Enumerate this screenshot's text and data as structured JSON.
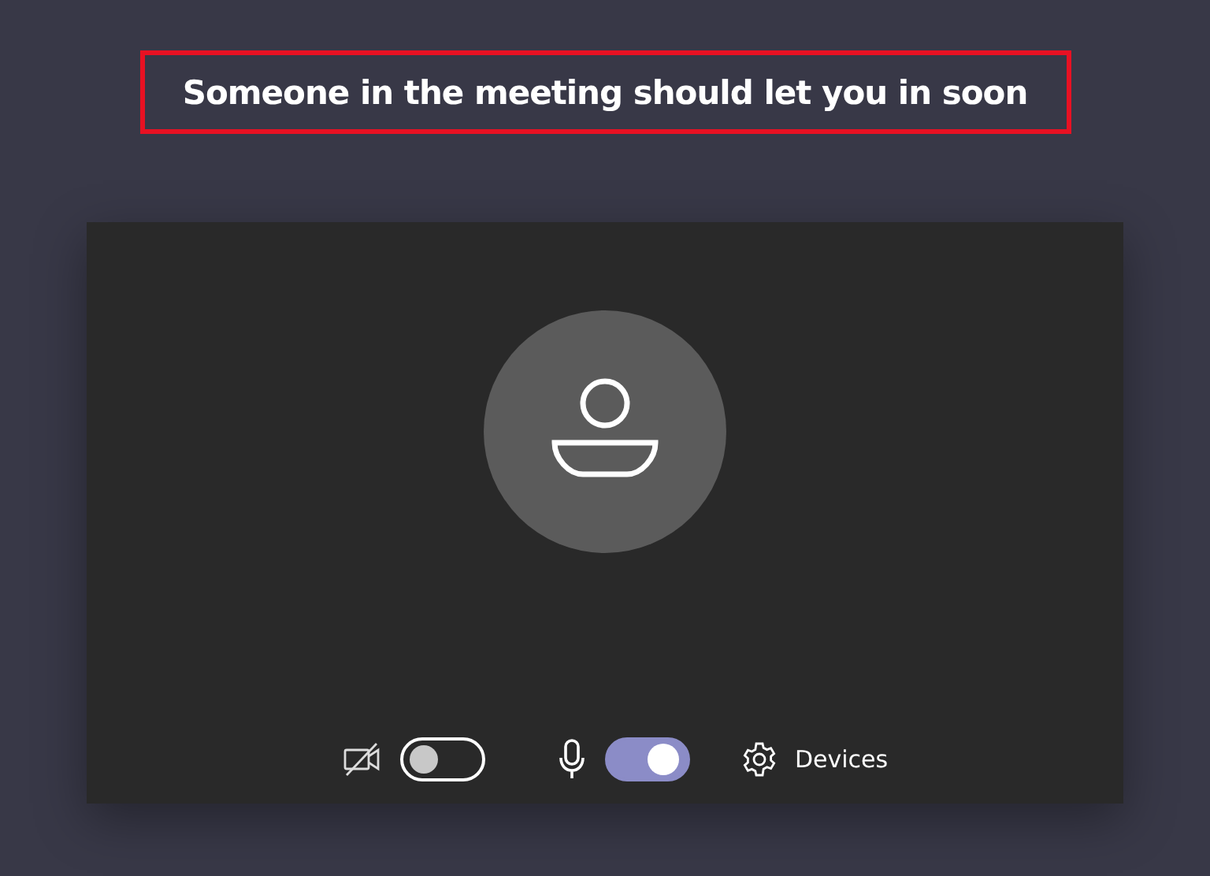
{
  "message": "Someone in the meeting should let you in soon",
  "controls": [
    {
      "kind": "camera",
      "on": false
    },
    {
      "kind": "mic",
      "on": true
    },
    {
      "kind": "devices",
      "label": "Devices"
    }
  ]
}
